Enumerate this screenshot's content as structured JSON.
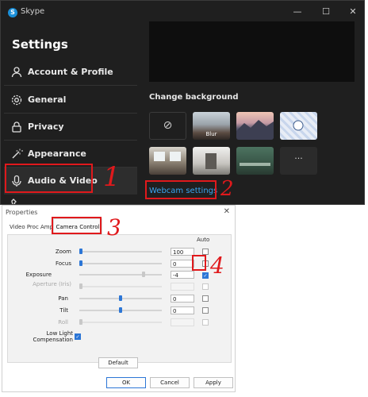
{
  "skype": {
    "title": "Skype",
    "app_icon_glyph": "S",
    "window_controls": [
      "—",
      "☐",
      "✕"
    ],
    "settings_title": "Settings",
    "nav": [
      {
        "label": "Account & Profile",
        "icon": "person-icon"
      },
      {
        "label": "General",
        "icon": "gear-icon"
      },
      {
        "label": "Privacy",
        "icon": "lock-icon"
      },
      {
        "label": "Appearance",
        "icon": "magic-wand-icon"
      },
      {
        "label": "Audio & Video",
        "icon": "microphone-icon",
        "active": true
      }
    ],
    "change_background_label": "Change background",
    "backgrounds": [
      {
        "caption": "",
        "type": "none",
        "glyph": "⊘"
      },
      {
        "caption": "Blur",
        "type": "blur"
      },
      {
        "caption": "",
        "type": "mountain"
      },
      {
        "caption": "",
        "type": "pattern"
      },
      {
        "caption": "",
        "type": "room"
      },
      {
        "caption": "",
        "type": "hallway"
      },
      {
        "caption": "",
        "type": "office"
      },
      {
        "caption": "",
        "type": "more",
        "glyph": "···"
      }
    ],
    "webcam_settings_link": "Webcam settings"
  },
  "annotations": [
    "1",
    "2",
    "3",
    "4"
  ],
  "properties": {
    "title": "Properties",
    "tabs": [
      "Video Proc Amp",
      "Camera Control"
    ],
    "active_tab": "Camera Control",
    "auto_header": "Auto",
    "controls": [
      {
        "label": "Zoom",
        "value": "100",
        "enabled": true,
        "auto": false,
        "level": 0.0
      },
      {
        "label": "Focus",
        "value": "0",
        "enabled": true,
        "auto": false,
        "level": 0.0
      },
      {
        "label": "Exposure",
        "value": "-4",
        "enabled": true,
        "auto": true,
        "level": 0.78
      },
      {
        "label": "Aperture (Iris)",
        "value": "",
        "enabled": false,
        "auto": false,
        "level": 0.0
      },
      {
        "label": "Pan",
        "value": "0",
        "enabled": true,
        "auto": false,
        "level": 0.5
      },
      {
        "label": "Tilt",
        "value": "0",
        "enabled": true,
        "auto": false,
        "level": 0.5
      },
      {
        "label": "Roll",
        "value": "",
        "enabled": false,
        "auto": false,
        "level": 0.0
      }
    ],
    "low_light_label": "Low Light Compensation",
    "low_light_checked": true,
    "default_button": "Default",
    "ok_button": "OK",
    "cancel_button": "Cancel",
    "apply_button": "Apply"
  },
  "colors": {
    "accent": "#2c76d6",
    "link": "#3aa5f0",
    "annotation_red": "#e0191c",
    "dark_bg": "#1f1f1f"
  }
}
